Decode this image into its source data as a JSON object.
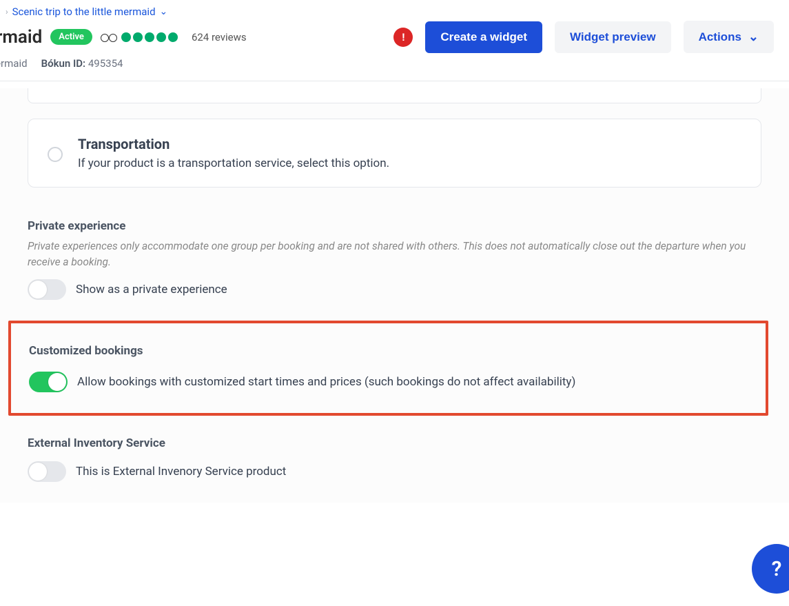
{
  "breadcrumb": {
    "link_text": "Scenic trip to the little mermaid"
  },
  "header": {
    "title_fragment": "ermaid",
    "status_badge": "Active",
    "reviews": "624 reviews",
    "subtitle_fragment": "Mermaid",
    "bokun_id_label": "Bókun ID:",
    "bokun_id_value": "495354"
  },
  "buttons": {
    "create_widget": "Create a widget",
    "widget_preview": "Widget preview",
    "actions": "Actions"
  },
  "transportation_card": {
    "title": "Transportation",
    "description": "If your product is a transportation service, select this option."
  },
  "private_experience": {
    "title": "Private experience",
    "subtitle": "Private experiences only accommodate one group per booking and are not shared with others. This does not automatically close out the departure when you receive a booking.",
    "toggle_label": "Show as a private experience",
    "toggle_state": false
  },
  "customized_bookings": {
    "title": "Customized bookings",
    "toggle_label": "Allow bookings with customized start times and prices (such bookings do not affect availability)",
    "toggle_state": true
  },
  "external_inventory": {
    "title": "External Inventory Service",
    "toggle_label": "This is External Invenory Service product",
    "toggle_state": false
  },
  "help": {
    "label": "?"
  },
  "alert": {
    "label": "!"
  }
}
